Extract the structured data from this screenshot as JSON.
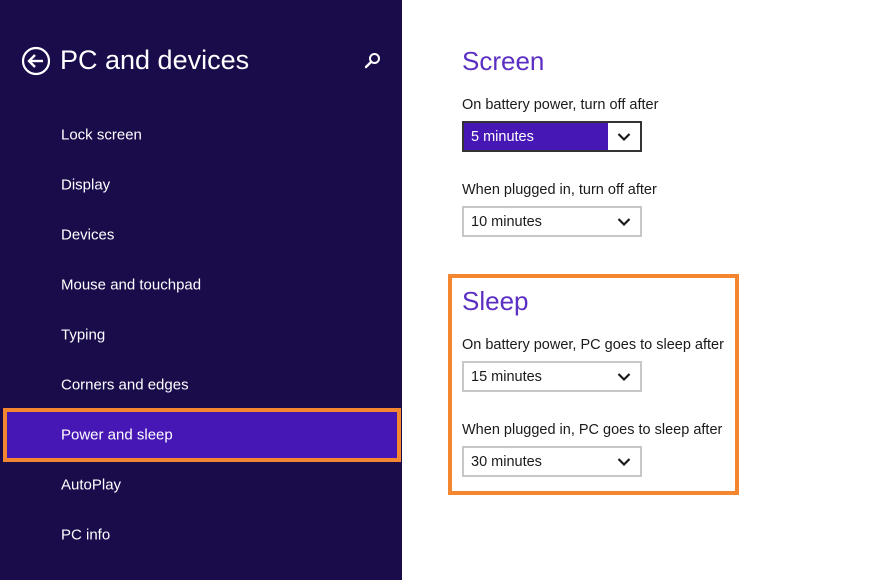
{
  "sidebar": {
    "title": "PC and devices",
    "back_icon": "back-arrow-circle-icon",
    "search_icon": "search-icon",
    "colors": {
      "background": "#1a0b4b",
      "selected": "#4617b4",
      "highlight_border": "#f3862e"
    },
    "items": [
      {
        "label": "Lock screen"
      },
      {
        "label": "Display"
      },
      {
        "label": "Devices"
      },
      {
        "label": "Mouse and touchpad"
      },
      {
        "label": "Typing"
      },
      {
        "label": "Corners and edges"
      },
      {
        "label": "Power and sleep"
      },
      {
        "label": "AutoPlay"
      },
      {
        "label": "PC info"
      }
    ],
    "selected_item": "Power and sleep"
  },
  "screen": {
    "title": "Screen",
    "battery_label": "On battery power, turn off after",
    "battery_value": "5 minutes",
    "plugged_label": "When plugged in, turn off after",
    "plugged_value": "10 minutes"
  },
  "sleep": {
    "title": "Sleep",
    "battery_label": "On battery power, PC goes to sleep after",
    "battery_value": "15 minutes",
    "plugged_label": "When plugged in, PC goes to sleep after",
    "plugged_value": "30 minutes"
  },
  "colors": {
    "accent": "#5b2fc4",
    "highlight": "#f3862e"
  }
}
